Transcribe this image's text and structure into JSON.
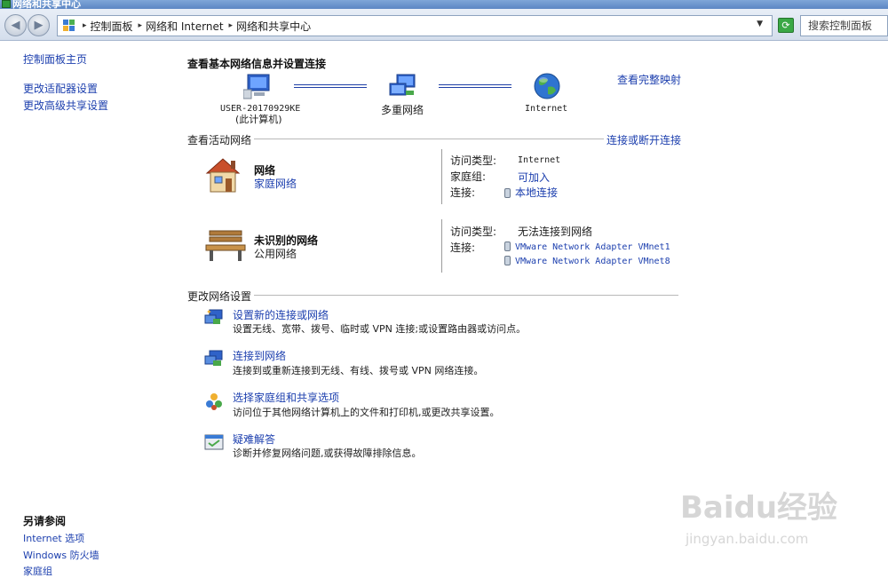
{
  "window": {
    "title": "网络和共享中心"
  },
  "addressbar": {
    "crumbs": [
      "控制面板",
      "网络和 Internet",
      "网络和共享中心"
    ],
    "search_placeholder": "搜索控制面板"
  },
  "sidebar": {
    "home": "控制面板主页",
    "items": [
      "更改适配器设置",
      "更改高级共享设置"
    ],
    "see_also_title": "另请参阅",
    "see_also": [
      "Internet 选项",
      "Windows 防火墙",
      "家庭组"
    ]
  },
  "main": {
    "title": "查看基本网络信息并设置连接",
    "full_map_link": "查看完整映射",
    "map": {
      "computer_name": "USER-20170929KE",
      "computer_sub": "(此计算机)",
      "middle": "多重网络",
      "internet": "Internet"
    },
    "active_header": "查看活动网络",
    "connect_link": "连接或断开连接",
    "networks": [
      {
        "name": "网络",
        "type": "家庭网络",
        "access_label": "访问类型:",
        "access_value": "Internet",
        "homegroup_label": "家庭组:",
        "homegroup_value": "可加入",
        "conn_label": "连接:",
        "connections": [
          "本地连接"
        ]
      },
      {
        "name": "未识别的网络",
        "type": "公用网络",
        "access_label": "访问类型:",
        "access_value": "无法连接到网络",
        "conn_label": "连接:",
        "connections": [
          "VMware Network Adapter VMnet1",
          "VMware Network Adapter VMnet8"
        ]
      }
    ],
    "change_header": "更改网络设置",
    "tasks": [
      {
        "title": "设置新的连接或网络",
        "desc": "设置无线、宽带、拨号、临时或 VPN 连接;或设置路由器或访问点。",
        "icon": "new-connection-icon"
      },
      {
        "title": "连接到网络",
        "desc": "连接到或重新连接到无线、有线、拨号或 VPN 网络连接。",
        "icon": "connect-network-icon"
      },
      {
        "title": "选择家庭组和共享选项",
        "desc": "访问位于其他网络计算机上的文件和打印机,或更改共享设置。",
        "icon": "homegroup-icon"
      },
      {
        "title": "疑难解答",
        "desc": "诊断并修复网络问题,或获得故障排除信息。",
        "icon": "troubleshoot-icon"
      }
    ]
  },
  "watermark": {
    "brand": "Baidu经验",
    "url": "jingyan.baidu.com"
  }
}
